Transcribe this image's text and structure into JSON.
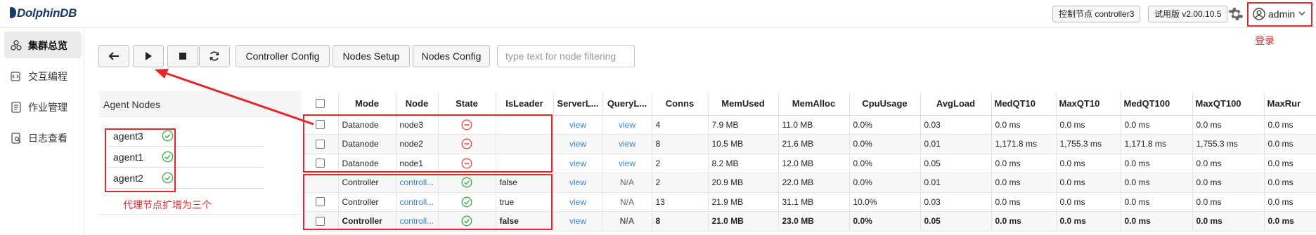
{
  "app": {
    "logo": "DolphinDB"
  },
  "header": {
    "controller_tag": "控制节点 controller3",
    "version_tag": "试用版 v2.00.10.5",
    "user": "admin",
    "login_annotation": "登录"
  },
  "sidebar": {
    "items": [
      {
        "label": "集群总览",
        "icon": "cluster-icon",
        "active": true
      },
      {
        "label": "交互编程",
        "icon": "code-icon",
        "active": false
      },
      {
        "label": "作业管理",
        "icon": "job-icon",
        "active": false
      },
      {
        "label": "日志查看",
        "icon": "log-icon",
        "active": false
      }
    ]
  },
  "toolbar": {
    "back_icon": "arrow-left-icon",
    "start_icon": "play-icon",
    "stop_icon": "stop-icon",
    "refresh_icon": "refresh-icon",
    "controller_config": "Controller Config",
    "nodes_setup": "Nodes Setup",
    "nodes_config": "Nodes Config",
    "filter_placeholder": "type text for node filtering"
  },
  "agents": {
    "title": "Agent Nodes",
    "items": [
      {
        "name": "agent3"
      },
      {
        "name": "agent1"
      },
      {
        "name": "agent2"
      }
    ],
    "annotation": "代理节点扩增为三个"
  },
  "table": {
    "columns": [
      "Mode",
      "Node",
      "State",
      "IsLeader",
      "ServerL...",
      "QueryL...",
      "Conns",
      "MemUsed",
      "MemAlloc",
      "CpuUsage",
      "AvgLoad",
      "MedQT10",
      "MaxQT10",
      "MedQT100",
      "MaxQT100",
      "MaxRur"
    ],
    "rows": [
      {
        "mode": "Datanode",
        "node": "node3",
        "state": "stopped",
        "isleader": "",
        "server": "view",
        "query": "view",
        "conns": "4",
        "memused": "7.9 MB",
        "memalloc": "11.0 MB",
        "cpu": "0.0%",
        "avgload": "0.03",
        "medqt10": "0.0 ms",
        "maxqt10": "0.0 ms",
        "medqt100": "0.0 ms",
        "maxqt100": "0.0 ms",
        "maxrun": "0.0 ms",
        "checkbox": true
      },
      {
        "mode": "Datanode",
        "node": "node2",
        "state": "stopped",
        "isleader": "",
        "server": "view",
        "query": "view",
        "conns": "8",
        "memused": "10.5 MB",
        "memalloc": "21.6 MB",
        "cpu": "0.0%",
        "avgload": "0.01",
        "medqt10": "1,171.8 ms",
        "maxqt10": "1,755.3 ms",
        "medqt100": "1,171.8 ms",
        "maxqt100": "1,755.3 ms",
        "maxrun": "0.0 ms",
        "checkbox": true
      },
      {
        "mode": "Datanode",
        "node": "node1",
        "state": "stopped",
        "isleader": "",
        "server": "view",
        "query": "view",
        "conns": "2",
        "memused": "8.2 MB",
        "memalloc": "12.0 MB",
        "cpu": "0.0%",
        "avgload": "0.05",
        "medqt10": "0.0 ms",
        "maxqt10": "0.0 ms",
        "medqt100": "0.0 ms",
        "maxqt100": "0.0 ms",
        "maxrun": "0.0 ms",
        "checkbox": true
      },
      {
        "mode": "Controller",
        "node": "controll...",
        "state": "running",
        "isleader": "false",
        "server": "view",
        "query": "N/A",
        "conns": "2",
        "memused": "20.9 MB",
        "memalloc": "22.0 MB",
        "cpu": "0.0%",
        "avgload": "0.01",
        "medqt10": "0.0 ms",
        "maxqt10": "0.0 ms",
        "medqt100": "0.0 ms",
        "maxqt100": "0.0 ms",
        "maxrun": "0.0 ms",
        "checkbox": false
      },
      {
        "mode": "Controller",
        "node": "controll...",
        "state": "running",
        "isleader": "true",
        "server": "view",
        "query": "N/A",
        "conns": "13",
        "memused": "21.9 MB",
        "memalloc": "31.1 MB",
        "cpu": "10.0%",
        "avgload": "0.03",
        "medqt10": "0.0 ms",
        "maxqt10": "0.0 ms",
        "medqt100": "0.0 ms",
        "maxqt100": "0.0 ms",
        "maxrun": "0.0 ms",
        "checkbox": true
      },
      {
        "mode": "Controller",
        "node": "controll...",
        "state": "running",
        "isleader": "false",
        "server": "view",
        "query": "N/A",
        "conns": "8",
        "memused": "21.0 MB",
        "memalloc": "23.0 MB",
        "cpu": "0.0%",
        "avgload": "0.05",
        "medqt10": "0.0 ms",
        "maxqt10": "0.0 ms",
        "medqt100": "0.0 ms",
        "maxqt100": "0.0 ms",
        "maxrun": "0.0 ms",
        "checkbox": true
      }
    ]
  },
  "colors": {
    "annotation_red": "#e0282e",
    "link_blue": "#3a86c8",
    "ok_green": "#3fb34f",
    "stop_red": "#d9534f"
  }
}
